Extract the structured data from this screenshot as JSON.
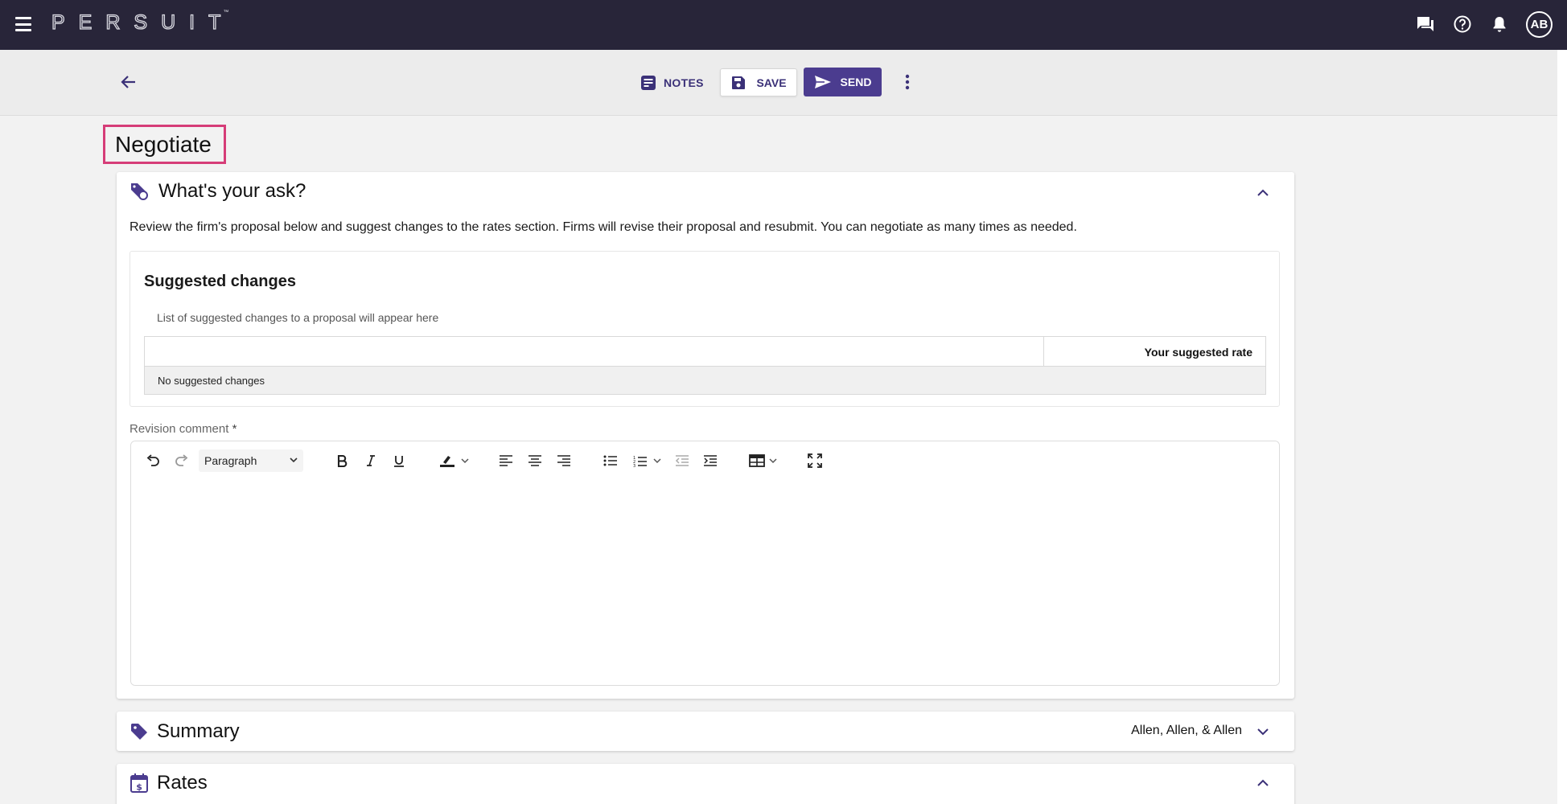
{
  "app": {
    "logo_text": "PERSUIT",
    "logo_tm": "™",
    "user_initials": "AB",
    "icons": [
      "menu-icon",
      "chat-icon",
      "help-icon",
      "notification-bell-icon"
    ]
  },
  "toolbar": {
    "notes_label": "NOTES",
    "save_label": "SAVE",
    "send_label": "SEND"
  },
  "page": {
    "title": "Negotiate"
  },
  "ask_section": {
    "title": "What's your ask?",
    "description": "Review the firm's proposal below and suggest changes to the rates section. Firms will revise their proposal and resubmit. You can negotiate as many times as needed.",
    "suggested_changes": {
      "title": "Suggested changes",
      "subtitle": "List of suggested changes to a proposal will appear here",
      "columns": [
        "",
        "Your suggested rate"
      ],
      "empty_text": "No suggested changes"
    },
    "revision_comment": {
      "label": "Revision comment",
      "required_marker": "*",
      "format_value": "Paragraph",
      "body": ""
    }
  },
  "summary_section": {
    "title": "Summary",
    "firm_name": "Allen, Allen, & Allen"
  },
  "rates_section": {
    "title": "Rates"
  },
  "colors": {
    "app_bar": "#282539",
    "accent": "#4b3c8f",
    "title_highlight": "#d63d78"
  }
}
